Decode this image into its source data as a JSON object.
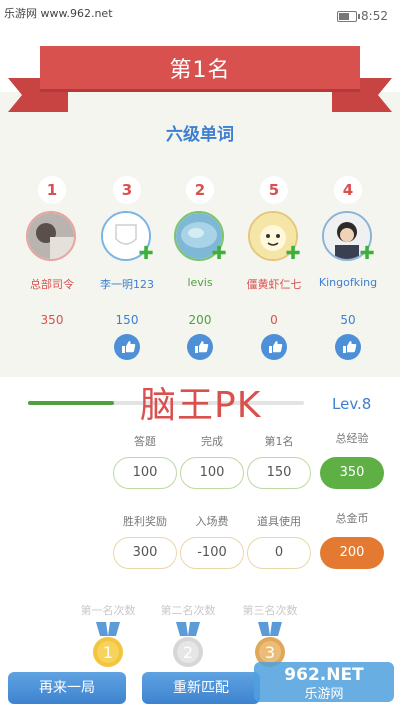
{
  "statusbar": {
    "watermark": "乐游网 www.962.net",
    "time": "8:52"
  },
  "ribbon": {
    "title": "第1名"
  },
  "category": "六级单词",
  "players": [
    {
      "rank": "1",
      "name": "总部司令",
      "score": "350",
      "name_color": "#d9514f",
      "score_color": "#d9514f",
      "avatar_border": "#e9a3a0",
      "rank_color": "#d9514f"
    },
    {
      "rank": "3",
      "name": "李一明123",
      "score": "150",
      "name_color": "#3e7fd0",
      "score_color": "#3e7fd0",
      "avatar_border": "#7ab4e6",
      "rank_color": "#d9514f"
    },
    {
      "rank": "2",
      "name": "levis",
      "score": "200",
      "name_color": "#4ea13f",
      "score_color": "#4ea13f",
      "avatar_border": "#7cc46a",
      "rank_color": "#d9514f"
    },
    {
      "rank": "5",
      "name": "僵黄虾仁七",
      "score": "0",
      "name_color": "#d9514f",
      "score_color": "#d9514f",
      "avatar_border": "#e7c67a",
      "rank_color": "#d9514f"
    },
    {
      "rank": "4",
      "name": "Kingofking",
      "score": "50",
      "name_color": "#3e7fd0",
      "score_color": "#3e7fd0",
      "avatar_border": "#8bb3d8",
      "rank_color": "#d9514f"
    }
  ],
  "game": {
    "title": "脑王PK",
    "level": "Lev.8",
    "progress": 0.31
  },
  "stats_row1": [
    {
      "label": "答题",
      "value": "100"
    },
    {
      "label": "完成",
      "value": "100"
    },
    {
      "label": "第1名",
      "value": "150"
    },
    {
      "label": "总经验",
      "value": "350"
    }
  ],
  "stats_row2": [
    {
      "label": "胜利奖励",
      "value": "300"
    },
    {
      "label": "入场费",
      "value": "-100"
    },
    {
      "label": "道具使用",
      "value": "0"
    },
    {
      "label": "总金币",
      "value": "200"
    }
  ],
  "medals": [
    {
      "label": "第一名次数",
      "number": "1",
      "color": "#f2c53d"
    },
    {
      "label": "第二名次数",
      "number": "2",
      "color": "#d6d6d6"
    },
    {
      "label": "第三名次数",
      "number": "3",
      "color": "#e0a85a"
    }
  ],
  "buttons": {
    "again": "再来一局",
    "rematch": "重新匹配"
  },
  "watermark_logo": {
    "text_top": "962.NET",
    "text_bottom": "乐游网"
  },
  "colors": {
    "ribbon": "#d9514f",
    "accent_blue": "#3e7fd0",
    "green": "#5eb044",
    "orange": "#e47a32"
  }
}
